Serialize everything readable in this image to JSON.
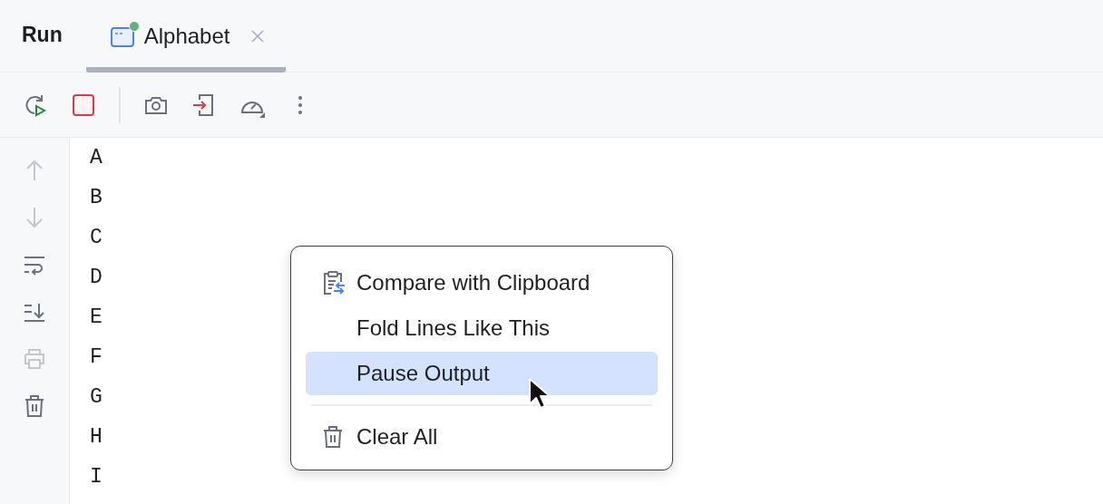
{
  "title": "Run",
  "tabs": [
    {
      "label": "Alphabet",
      "selected": true,
      "running": true
    }
  ],
  "toolbar": [
    {
      "kind": "rerun"
    },
    {
      "kind": "stop"
    },
    {
      "kind": "separator"
    },
    {
      "kind": "camera"
    },
    {
      "kind": "exit"
    },
    {
      "kind": "gauge"
    },
    {
      "kind": "more"
    }
  ],
  "side_tools": [
    {
      "kind": "up",
      "disabled": true
    },
    {
      "kind": "down",
      "disabled": true
    },
    {
      "kind": "wrap",
      "disabled": false
    },
    {
      "kind": "scroll",
      "disabled": false
    },
    {
      "kind": "print",
      "disabled": true
    },
    {
      "kind": "trash",
      "disabled": false
    }
  ],
  "console_lines": [
    "A",
    "B",
    "C",
    "D",
    "E",
    "F",
    "G",
    "H",
    "I"
  ],
  "context_menu": [
    {
      "kind": "clipboard",
      "label": "Compare with Clipboard",
      "selected": false
    },
    {
      "kind": "plain",
      "label": "Fold Lines Like This",
      "selected": false
    },
    {
      "kind": "plain",
      "label": "Pause Output",
      "selected": true
    },
    {
      "kind": "separator"
    },
    {
      "kind": "trash",
      "label": "Clear All",
      "selected": false
    }
  ]
}
